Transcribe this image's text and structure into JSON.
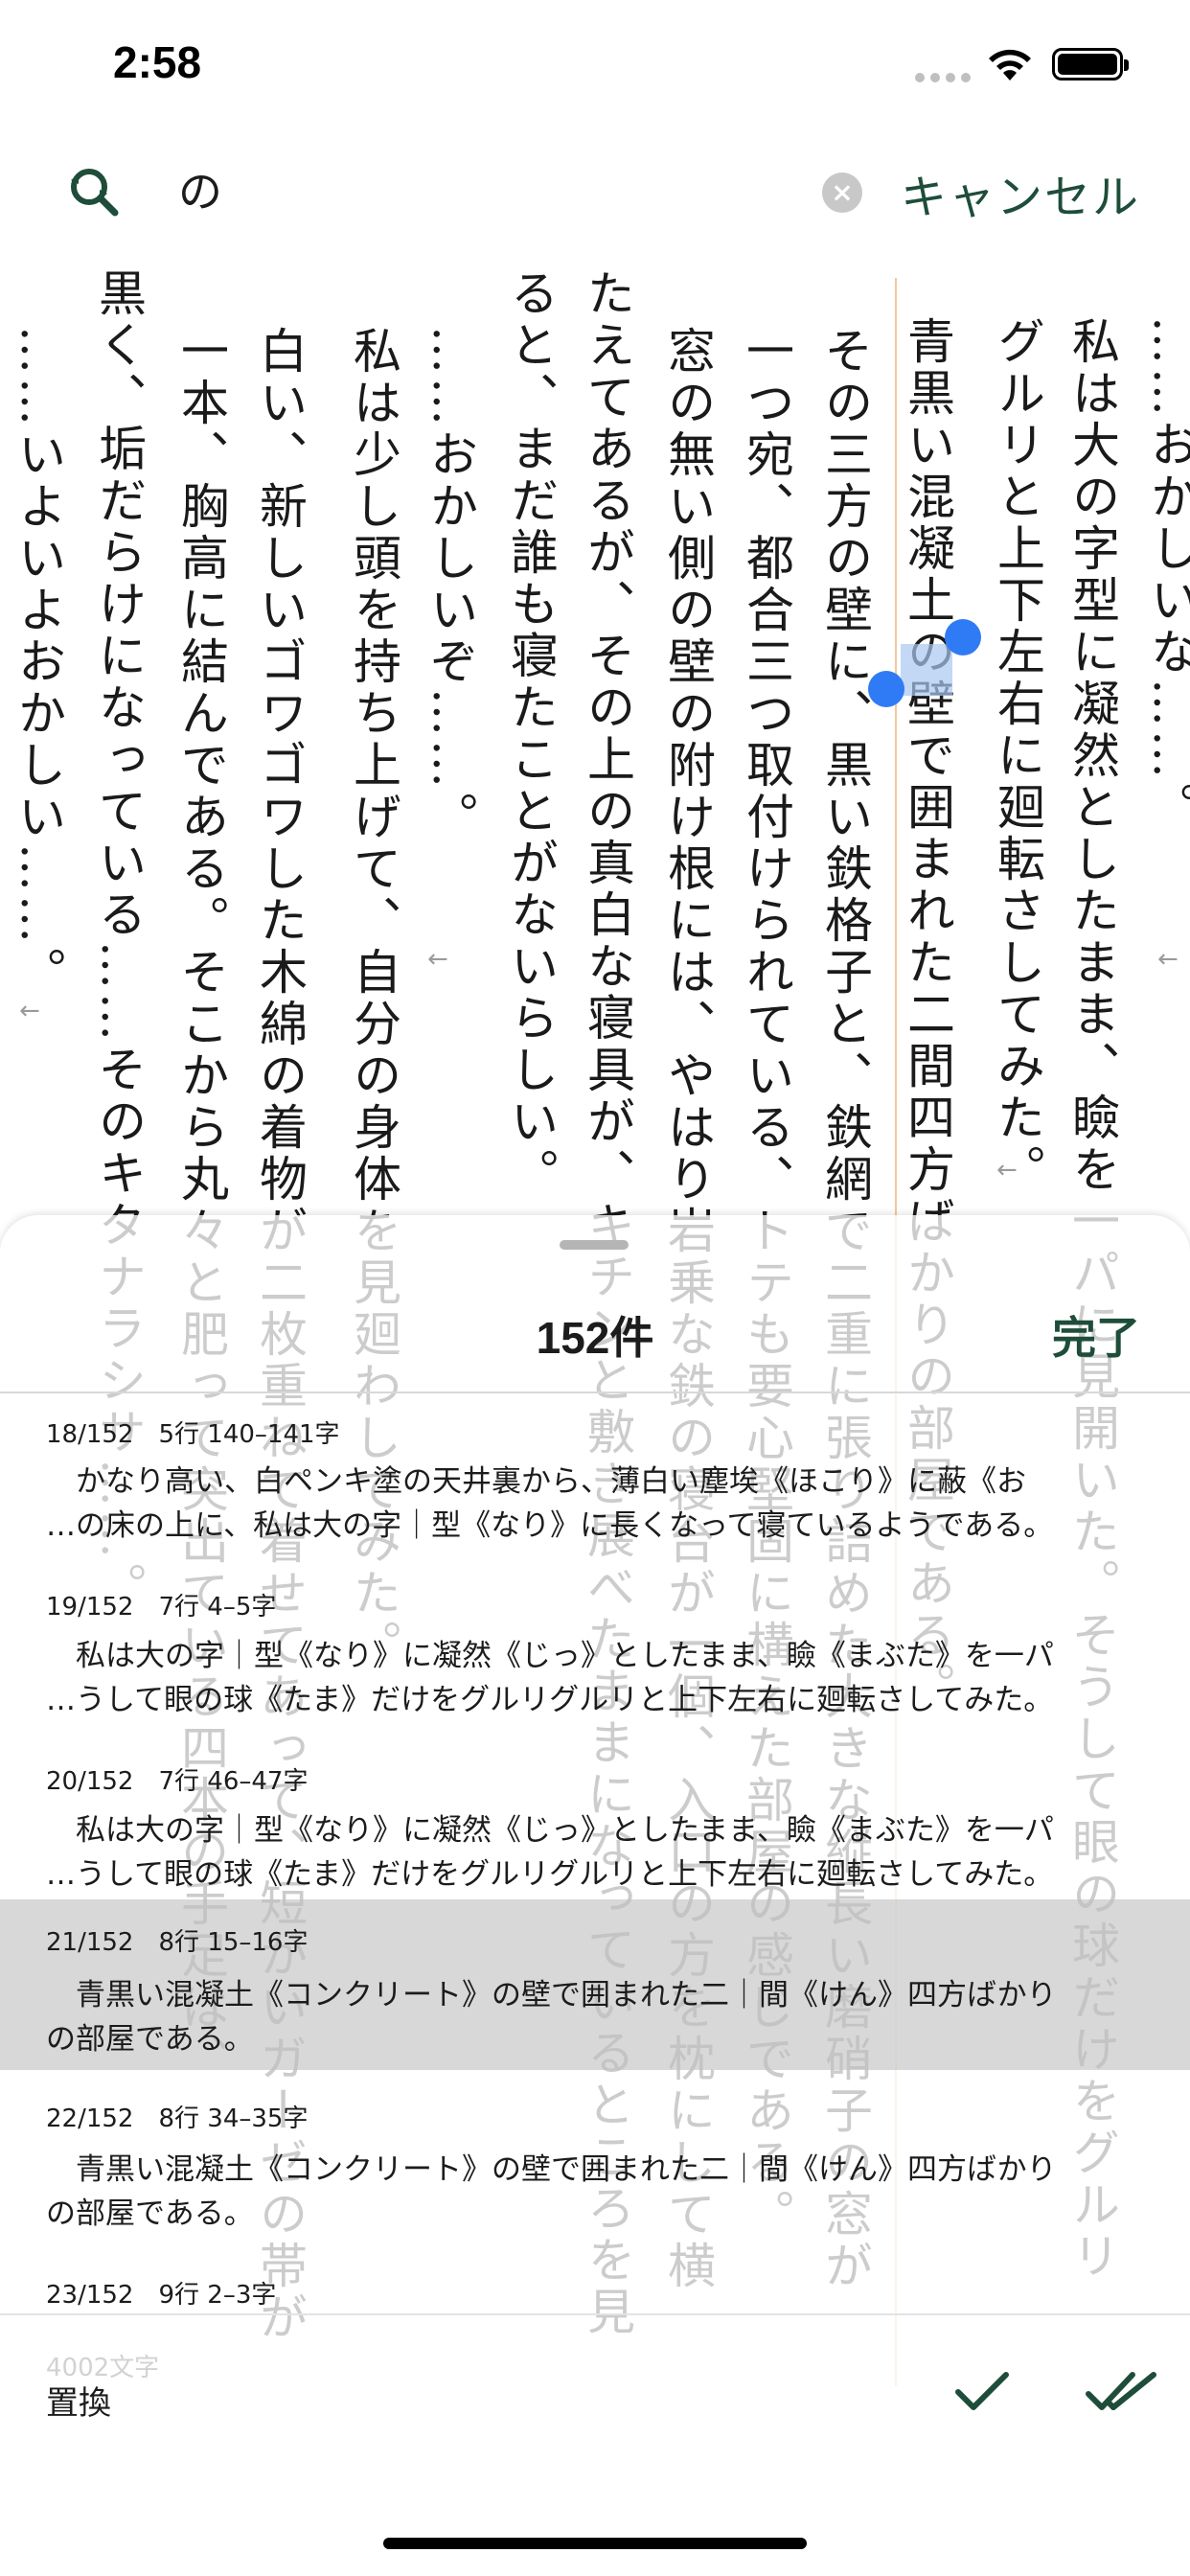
{
  "status_bar": {
    "time": "2:58"
  },
  "search": {
    "query": "の",
    "cancel_label": "キャンセル"
  },
  "reader": {
    "columns": [
      "……おかしいな……。",
      "私は大の字型に凝然としたまま、瞼を一パに見開いた。そうして眼の球だけをグルリ",
      "グルリと上下左右に廻転さしてみた。",
      "青黒い混凝土の壁で囲まれた二間四方ばかりの部屋である。",
      "その三方の壁に、黒い鉄格子と、鉄網で二重に張り詰めた大きな縦長い磨硝子の窓が",
      "一つ宛、都合三つ取付けられている、トテも要心堅固に構えた部屋の感じである。",
      "窓の無い側の壁の附け根には、やはり岩乗な鉄の寝台が一個、入口の方を枕にして横",
      "たえてあるが、その上の真白な寝具が、キチンと敷き展べたままになっているところを見",
      "ると、まだ誰も寝たことがないらしい。",
      "……おかしいぞ……。",
      "私は少し頭を持ち上げて、自分の身体を見廻わしてみた。",
      "白い、新しいゴワゴワした木綿の着物が二枚重ねて着せてあって、短かいガーゼの帯が",
      "一本、胸高に結んである。そこから丸々と肥って突出ている四本の手足は、",
      "黒く、垢だらけになっている……そのキタナラシサ……。",
      "……いよいよおかしい……。"
    ]
  },
  "results": {
    "title": "152件",
    "done_label": "完了",
    "items": [
      {
        "head": "18/152　5行 140–141字",
        "line1": "　かなり高い、白ペンキ塗の天井裏から、薄白い塵埃《ほこり》に蔽《お",
        "line2": "…の床の上に、私は大の字｜型《なり》に長くなって寝ているようである。"
      },
      {
        "head": "19/152　7行 4–5字",
        "line1": "　私は大の字｜型《なり》に凝然《じっ》としたまま、瞼《まぶた》を一パ",
        "line2": "…うして眼の球《たま》だけをグルリグルリと上下左右に廻転さしてみた。"
      },
      {
        "head": "20/152　7行 46–47字",
        "line1": "　私は大の字｜型《なり》に凝然《じっ》としたまま、瞼《まぶた》を一パ",
        "line2": "…うして眼の球《たま》だけをグルリグルリと上下左右に廻転さしてみた。"
      },
      {
        "head": "21/152　8行 15–16字",
        "line1": "　青黒い混凝土《コンクリート》の壁で囲まれた二｜間《けん》四方ばかり",
        "line2": "の部屋である。"
      },
      {
        "head": "22/152　8行 34–35字",
        "line1": "　青黒い混凝土《コンクリート》の壁で囲まれた二｜間《けん》四方ばかり",
        "line2": "の部屋である。"
      },
      {
        "head": "23/152　9行 2–3字",
        "line1": "",
        "line2": ""
      }
    ]
  },
  "footer": {
    "char_count": "4002文字",
    "replace_label": "置換"
  },
  "colors": {
    "accent": "#1e4d3a",
    "highlight": "#a9c8ef",
    "handle": "#2f7bf5",
    "selected_row": "#c9c9c9"
  }
}
